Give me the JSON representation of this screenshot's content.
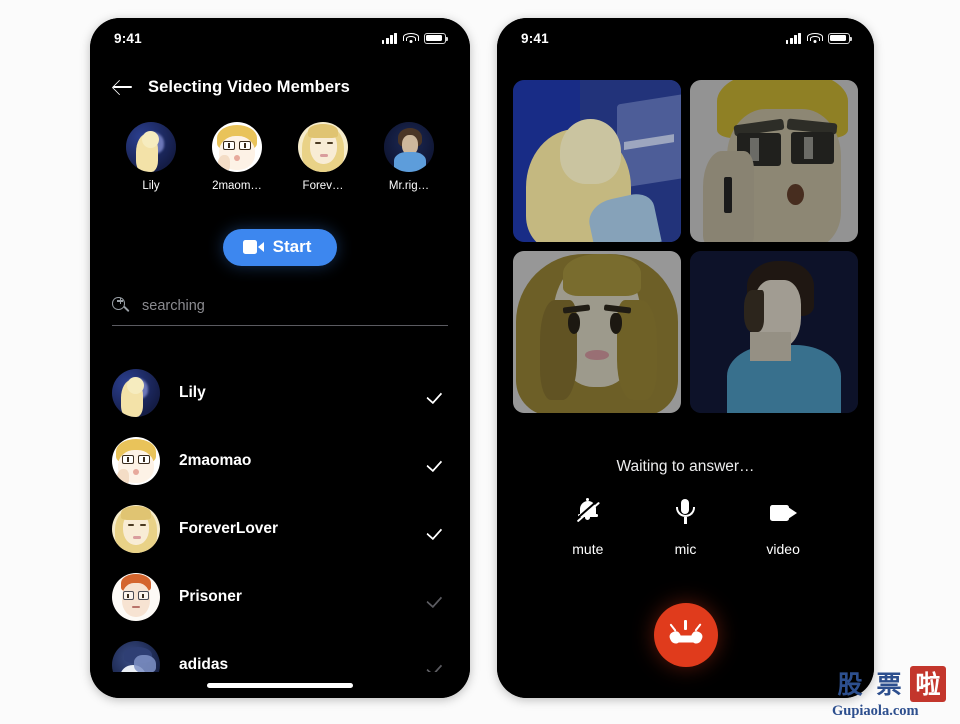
{
  "page": {
    "background": "#fbfbfb"
  },
  "colors": {
    "accent_blue": "#3d87ef",
    "hangup_red": "#e03b1c",
    "screen_black": "#000000",
    "check_on": "#ffffff",
    "check_off": "#5a5a5f",
    "muted_text": "#8b8b90"
  },
  "left_phone": {
    "status_bar": {
      "time": "9:41",
      "signal_icon": "cellular-bars-icon",
      "wifi_icon": "wifi-icon",
      "battery_icon": "battery-icon"
    },
    "header": {
      "back_icon": "back-arrow-icon",
      "title": "Selecting Video Members"
    },
    "selected_chips": [
      {
        "name": "Lily",
        "avatar": "lily-avatar"
      },
      {
        "name": "2maom…",
        "avatar": "maomao-avatar"
      },
      {
        "name": "Forev…",
        "avatar": "foreverlover-avatar"
      },
      {
        "name": "Mr.rig…",
        "avatar": "mrright-avatar"
      }
    ],
    "start_button": {
      "label": "Start",
      "icon": "video-camera-icon"
    },
    "search": {
      "icon": "search-zoom-in-icon",
      "value": "",
      "placeholder": "searching"
    },
    "contacts": [
      {
        "name": "Lily",
        "selected": true,
        "avatar": "lily-avatar"
      },
      {
        "name": "2maomao",
        "selected": true,
        "avatar": "maomao-avatar"
      },
      {
        "name": "ForeverLover",
        "selected": true,
        "avatar": "foreverlover-avatar"
      },
      {
        "name": "Prisoner",
        "selected": false,
        "avatar": "prisoner-avatar"
      },
      {
        "name": "adidas",
        "selected": false,
        "avatar": "adidas-avatar"
      }
    ],
    "home_indicator": "home-indicator"
  },
  "right_phone": {
    "status_bar": {
      "time": "9:41",
      "signal_icon": "cellular-bars-icon",
      "wifi_icon": "wifi-icon",
      "battery_icon": "battery-icon"
    },
    "video_tiles": [
      {
        "participant": "blonde-woman-blue-room"
      },
      {
        "participant": "blonde-man-sunglasses"
      },
      {
        "participant": "long-hair-woman-grey"
      },
      {
        "participant": "dark-hair-man-blue-shirt"
      }
    ],
    "status_text": "Waiting to answer…",
    "controls": [
      {
        "label": "mute",
        "icon": "bell-off-icon"
      },
      {
        "label": "mic",
        "icon": "microphone-icon"
      },
      {
        "label": "video",
        "icon": "video-camera-icon"
      }
    ],
    "hangup_button": {
      "icon": "hang-up-phone-icon",
      "color": "#e03b1c"
    }
  },
  "watermark": {
    "chars": [
      "股",
      "票",
      "啦"
    ],
    "url": "Gupiaola.com"
  }
}
